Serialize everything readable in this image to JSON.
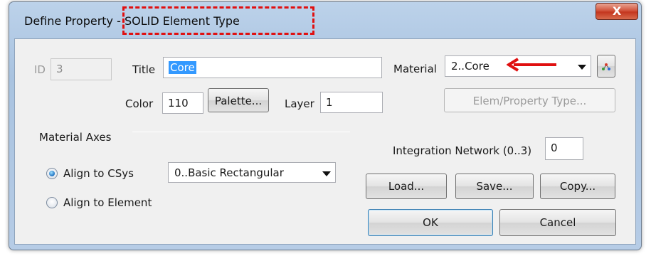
{
  "window": {
    "title": "Define Property - SOLID Element Type",
    "close_glyph": "X"
  },
  "id_field": {
    "label": "ID",
    "value": "3"
  },
  "title_field": {
    "label": "Title",
    "value": "Core"
  },
  "color_field": {
    "label": "Color",
    "value": "110"
  },
  "palette_button": {
    "label": "Palette..."
  },
  "layer_field": {
    "label": "Layer",
    "value": "1"
  },
  "material": {
    "label": "Material",
    "value": "2..Core",
    "pick_icon": "material-picker-icon"
  },
  "elem_property_type_button": {
    "label": "Elem/Property Type..."
  },
  "material_axes": {
    "label": "Material Axes",
    "align_csys_label": "Align to CSys",
    "align_csys_selected": true,
    "align_element_label": "Align to Element",
    "csys_value": "0..Basic Rectangular"
  },
  "integration": {
    "label": "Integration Network (0..3)",
    "value": "0"
  },
  "buttons": {
    "load": "Load...",
    "save": "Save...",
    "copy": "Copy...",
    "ok": "OK",
    "cancel": "Cancel"
  },
  "colors": {
    "annotation_red": "#e01010",
    "selection_blue": "#3399ff",
    "titlebar_blue": "#b6cce6"
  }
}
